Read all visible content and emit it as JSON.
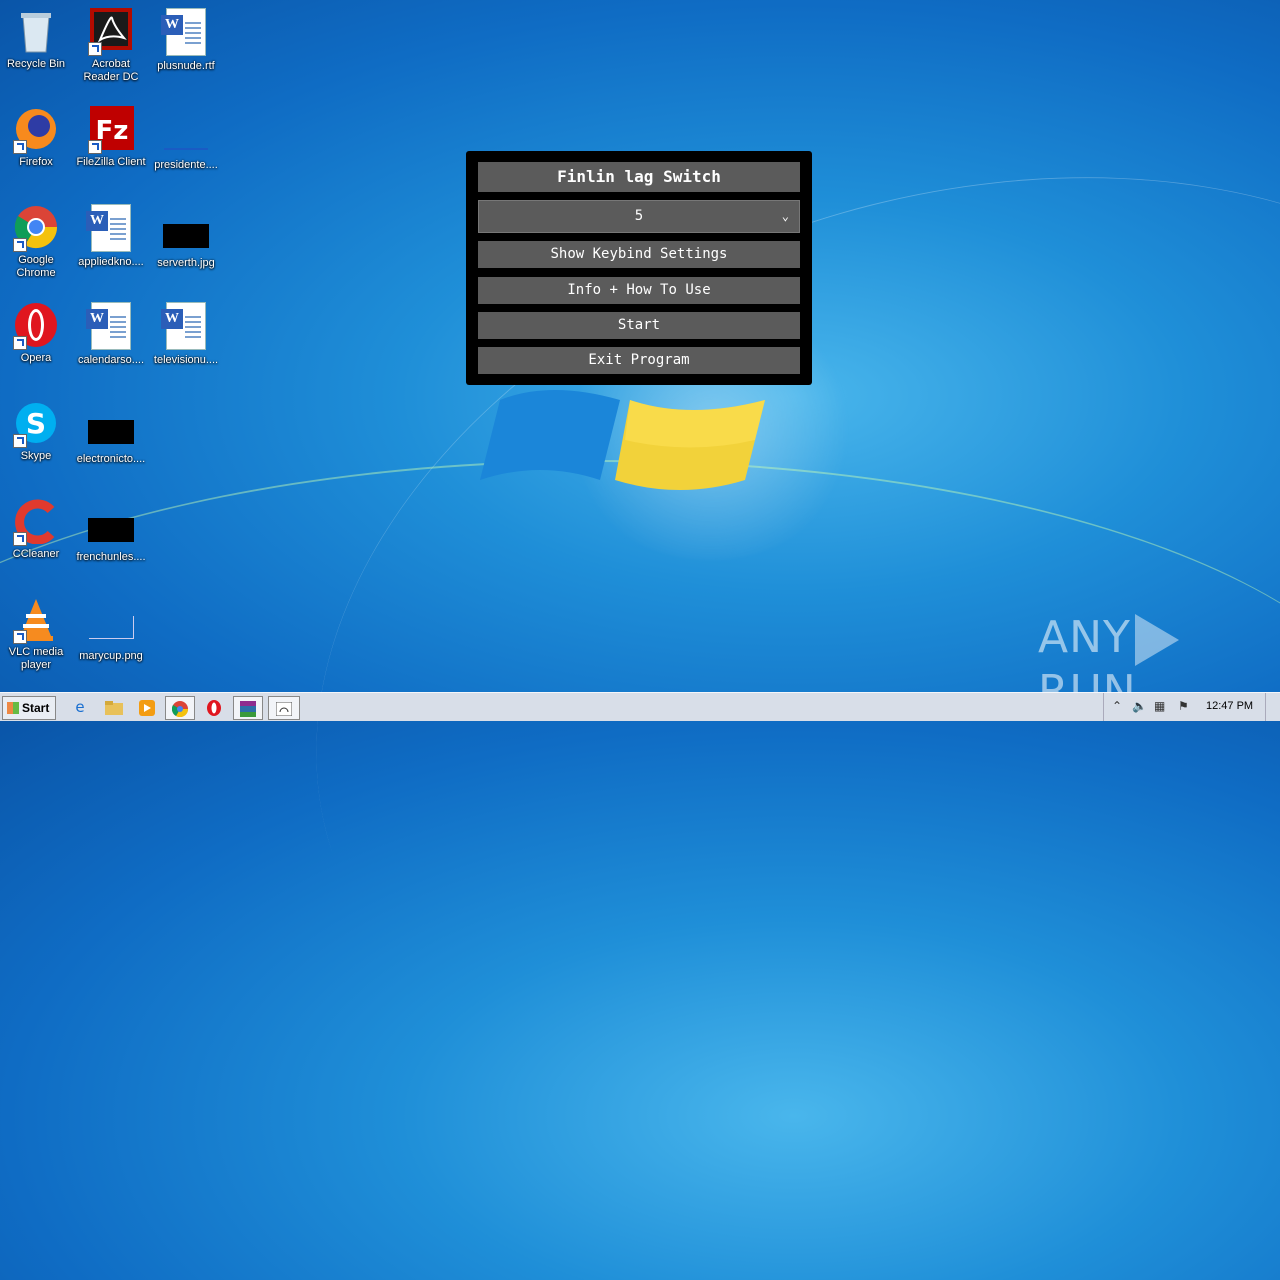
{
  "desktop": {
    "icons": [
      {
        "label": "Recycle Bin",
        "icon": "recycle-bin-icon"
      },
      {
        "label": "Acrobat\nReader DC",
        "icon": "acrobat-icon"
      },
      {
        "label": "plusnude.rtf",
        "icon": "word-doc-icon"
      },
      {
        "label": "Firefox",
        "icon": "firefox-icon"
      },
      {
        "label": "FileZilla Client",
        "icon": "filezilla-icon"
      },
      {
        "label": "presidente....",
        "icon": "file-thumbnail-icon"
      },
      {
        "label": "Google\nChrome",
        "icon": "chrome-icon"
      },
      {
        "label": "appliedkno....",
        "icon": "word-doc-icon"
      },
      {
        "label": "serverth.jpg",
        "icon": "image-thumbnail-icon"
      },
      {
        "label": "Opera",
        "icon": "opera-icon"
      },
      {
        "label": "calendarso....",
        "icon": "word-doc-icon"
      },
      {
        "label": "televisionu....",
        "icon": "word-doc-icon"
      },
      {
        "label": "Skype",
        "icon": "skype-icon"
      },
      {
        "label": "electronicto....",
        "icon": "image-thumbnail-icon"
      },
      {
        "label": "CCleaner",
        "icon": "ccleaner-icon"
      },
      {
        "label": "frenchunles....",
        "icon": "image-thumbnail-icon"
      },
      {
        "label": "VLC media\nplayer",
        "icon": "vlc-icon"
      },
      {
        "label": "marycup.png",
        "icon": "image-thumbnail-icon"
      }
    ]
  },
  "app": {
    "title": "Finlin lag Switch",
    "dropdown_value": "5",
    "buttons": {
      "keybind": "Show Keybind Settings",
      "info": "Info + How To Use",
      "start": "Start",
      "exit": "Exit Program"
    },
    "colors": {
      "background": "#000000",
      "control": "#5b5b5b",
      "text": "#ffffff"
    }
  },
  "taskbar": {
    "start_label": "Start",
    "clock": "12:47 PM",
    "pinned": [
      "internet-explorer-icon",
      "explorer-folder-icon",
      "media-player-icon",
      "chrome-icon",
      "opera-icon",
      "winrar-icon",
      "running-app-icon"
    ]
  },
  "watermark": {
    "left": "ANY",
    "right": "RUN"
  }
}
